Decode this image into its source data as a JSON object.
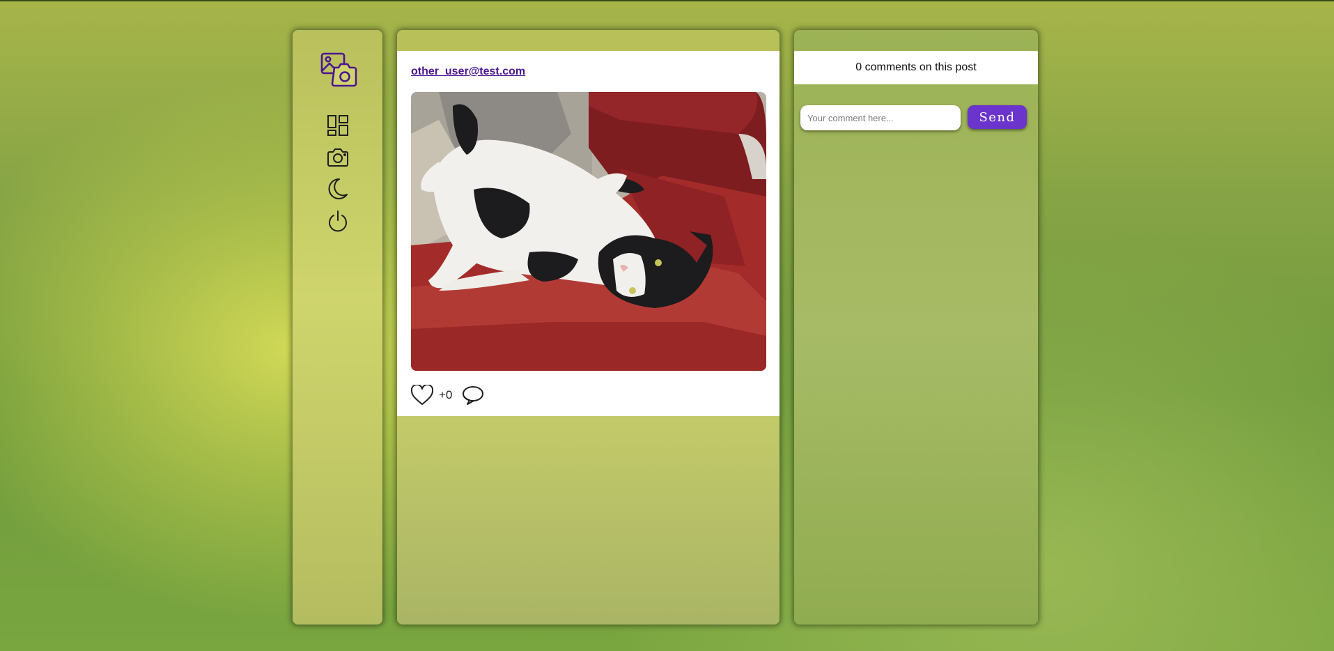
{
  "sidebar": {
    "logo_icon": "photo-camera-logo-icon",
    "nav": [
      {
        "icon": "dashboard-icon"
      },
      {
        "icon": "camera-icon"
      },
      {
        "icon": "moon-icon"
      },
      {
        "icon": "power-icon"
      }
    ]
  },
  "post": {
    "author": "other_user@test.com",
    "image_alt": "Cat lying on a red couch",
    "likes": "+0",
    "like_icon": "heart-icon",
    "comment_icon": "speech-bubble-icon"
  },
  "comments": {
    "count_label": "0 comments on this post",
    "input_placeholder": "Your comment here...",
    "input_value": "",
    "send_label": "Send"
  },
  "colors": {
    "accent": "#6b34cc",
    "author_link": "#4b1591",
    "logo": "#4b1591"
  }
}
